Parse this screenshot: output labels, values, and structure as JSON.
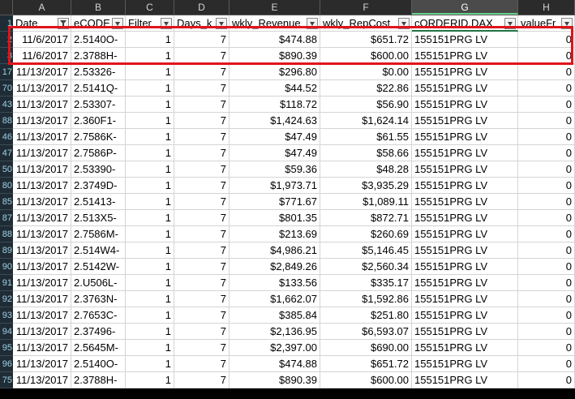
{
  "columns": [
    {
      "letter": "A",
      "header": "Date",
      "filter": "active"
    },
    {
      "letter": "B",
      "header": "eCODE",
      "filter": "dropdown"
    },
    {
      "letter": "C",
      "header": "Filter",
      "filter": "dropdown"
    },
    {
      "letter": "D",
      "header": "Days_k",
      "filter": "dropdown"
    },
    {
      "letter": "E",
      "header": "wkly_Revenue",
      "filter": "dropdown"
    },
    {
      "letter": "F",
      "header": "wkly_RepCost",
      "filter": "dropdown"
    },
    {
      "letter": "G",
      "header": "cORDERID.DAX",
      "filter": "dropdown"
    },
    {
      "letter": "H",
      "header": "valueFr",
      "filter": "dropdown"
    }
  ],
  "selected_column": "G",
  "rows": [
    {
      "num": "2",
      "cells": [
        "11/6/2017",
        "2.5140O-",
        "1",
        "7",
        "$474.88",
        "$651.72",
        "155151PRG LV",
        "0"
      ]
    },
    {
      "num": "3",
      "cells": [
        "11/6/2017",
        "2.3788H-",
        "1",
        "7",
        "$890.39",
        "$600.00",
        "155151PRG LV",
        "0"
      ]
    },
    {
      "num": "17",
      "cells": [
        "11/13/2017",
        "2.53326-",
        "1",
        "7",
        "$296.80",
        "$0.00",
        "155151PRG LV",
        "0"
      ]
    },
    {
      "num": "70",
      "cells": [
        "11/13/2017",
        "2.5141Q-",
        "1",
        "7",
        "$44.52",
        "$22.86",
        "155151PRG LV",
        "0"
      ]
    },
    {
      "num": "43",
      "cells": [
        "11/13/2017",
        "2.53307-",
        "1",
        "7",
        "$118.72",
        "$56.90",
        "155151PRG LV",
        "0"
      ]
    },
    {
      "num": "88",
      "cells": [
        "11/13/2017",
        "2.360F1-",
        "1",
        "7",
        "$1,424.63",
        "$1,624.14",
        "155151PRG LV",
        "0"
      ]
    },
    {
      "num": "46",
      "cells": [
        "11/13/2017",
        "2.7586K-",
        "1",
        "7",
        "$47.49",
        "$61.55",
        "155151PRG LV",
        "0"
      ]
    },
    {
      "num": "47",
      "cells": [
        "11/13/2017",
        "2.7586P-",
        "1",
        "7",
        "$47.49",
        "$58.66",
        "155151PRG LV",
        "0"
      ]
    },
    {
      "num": "50",
      "cells": [
        "11/13/2017",
        "2.53390-",
        "1",
        "7",
        "$59.36",
        "$48.28",
        "155151PRG LV",
        "0"
      ]
    },
    {
      "num": "80",
      "cells": [
        "11/13/2017",
        "2.3749D-",
        "1",
        "7",
        "$1,973.71",
        "$3,935.29",
        "155151PRG LV",
        "0"
      ]
    },
    {
      "num": "85",
      "cells": [
        "11/13/2017",
        "2.51413-",
        "1",
        "7",
        "$771.67",
        "$1,089.11",
        "155151PRG LV",
        "0"
      ]
    },
    {
      "num": "87",
      "cells": [
        "11/13/2017",
        "2.513X5-",
        "1",
        "7",
        "$801.35",
        "$872.71",
        "155151PRG LV",
        "0"
      ]
    },
    {
      "num": "88",
      "cells": [
        "11/13/2017",
        "2.7586M-",
        "1",
        "7",
        "$213.69",
        "$260.69",
        "155151PRG LV",
        "0"
      ]
    },
    {
      "num": "89",
      "cells": [
        "11/13/2017",
        "2.514W4-",
        "1",
        "7",
        "$4,986.21",
        "$5,146.45",
        "155151PRG LV",
        "0"
      ]
    },
    {
      "num": "90",
      "cells": [
        "11/13/2017",
        "2.5142W-",
        "1",
        "7",
        "$2,849.26",
        "$2,560.34",
        "155151PRG LV",
        "0"
      ]
    },
    {
      "num": "91",
      "cells": [
        "11/13/2017",
        "2.U506L-",
        "1",
        "7",
        "$133.56",
        "$335.17",
        "155151PRG LV",
        "0"
      ]
    },
    {
      "num": "92",
      "cells": [
        "11/13/2017",
        "2.3763N-",
        "1",
        "7",
        "$1,662.07",
        "$1,592.86",
        "155151PRG LV",
        "0"
      ]
    },
    {
      "num": "93",
      "cells": [
        "11/13/2017",
        "2.7653C-",
        "1",
        "7",
        "$385.84",
        "$251.80",
        "155151PRG LV",
        "0"
      ]
    },
    {
      "num": "94",
      "cells": [
        "11/13/2017",
        "2.37496-",
        "1",
        "7",
        "$2,136.95",
        "$6,593.07",
        "155151PRG LV",
        "0"
      ]
    },
    {
      "num": "95",
      "cells": [
        "11/13/2017",
        "2.5645M-",
        "1",
        "7",
        "$2,397.00",
        "$690.00",
        "155151PRG LV",
        "0"
      ]
    },
    {
      "num": "96",
      "cells": [
        "11/13/2017",
        "2.5140O-",
        "1",
        "7",
        "$474.88",
        "$651.72",
        "155151PRG LV",
        "0"
      ]
    },
    {
      "num": "75",
      "cells": [
        "11/13/2017",
        "2.3788H-",
        "1",
        "7",
        "$890.39",
        "$600.00",
        "155151PRG LV",
        "0"
      ]
    }
  ],
  "colors": {
    "annotation": "#e0141c",
    "row_gutter": "#1f2c35",
    "header_bar": "#2b2b2b"
  }
}
